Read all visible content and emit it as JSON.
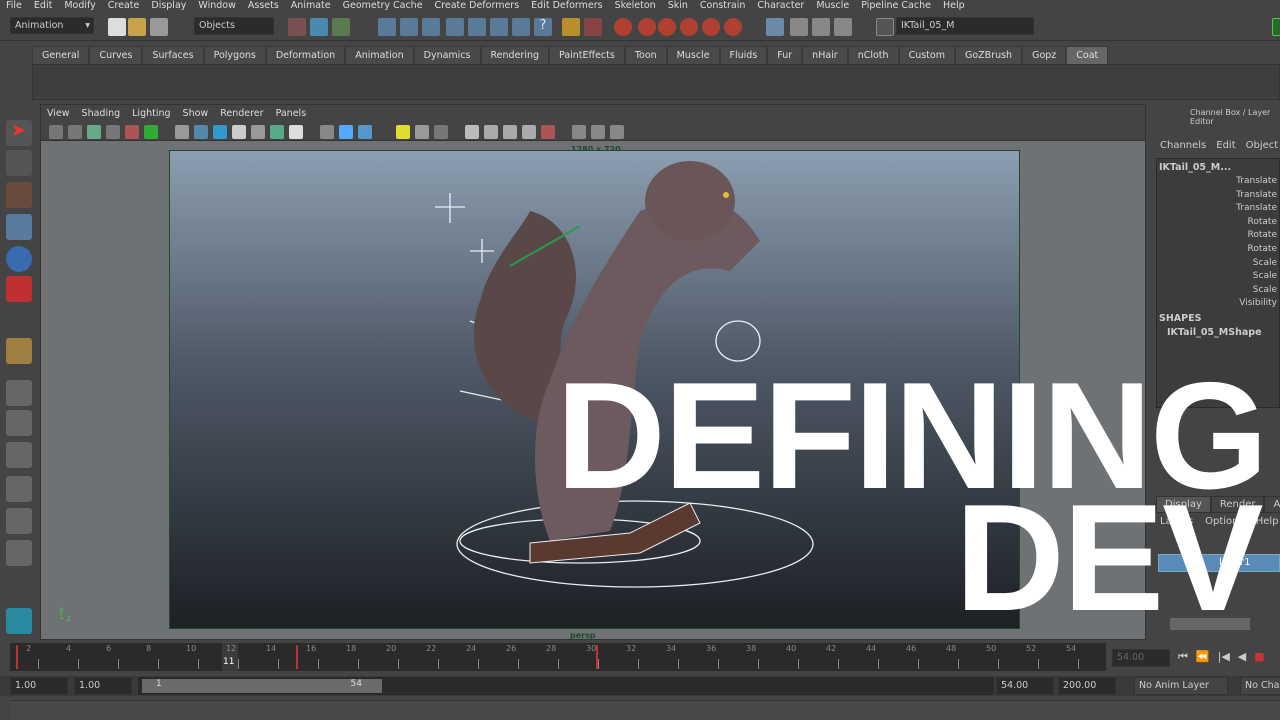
{
  "menus": [
    "File",
    "Edit",
    "Modify",
    "Create",
    "Display",
    "Window",
    "Assets",
    "Animate",
    "Geometry Cache",
    "Create Deformers",
    "Edit Deformers",
    "Skeleton",
    "Skin",
    "Constrain",
    "Character",
    "Muscle",
    "Pipeline Cache",
    "Help"
  ],
  "toolbar": {
    "mode": "Animation",
    "selection_mask": "Objects",
    "selected_object": "IKTail_05_M"
  },
  "shelf_tabs": [
    "General",
    "Curves",
    "Surfaces",
    "Polygons",
    "Deformation",
    "Animation",
    "Dynamics",
    "Rendering",
    "PaintEffects",
    "Toon",
    "Muscle",
    "Fluids",
    "Fur",
    "nHair",
    "nCloth",
    "Custom",
    "GoZBrush",
    "Gopz",
    "Coat"
  ],
  "shelf_active": "Coat",
  "viewport": {
    "menus": [
      "View",
      "Shading",
      "Lighting",
      "Show",
      "Renderer",
      "Panels"
    ],
    "resolution": "1280 x 720",
    "camera": "persp"
  },
  "channel_box": {
    "title": "Channel Box / Layer Editor",
    "menus": [
      "Channels",
      "Edit",
      "Object"
    ],
    "object": "IKTail_05_M...",
    "channels": [
      "Translate",
      "Translate",
      "Translate",
      "Rotate",
      "Rotate",
      "Rotate",
      "Scale",
      "Scale",
      "Scale",
      "Visibility"
    ],
    "shapes_label": "SHAPES",
    "shape": "IKTail_05_MShape"
  },
  "layer_editor": {
    "tabs": [
      "Display",
      "Render",
      "Anim"
    ],
    "menus": [
      "Layers",
      "Options",
      "Help"
    ],
    "layer": "layer1"
  },
  "timeline": {
    "ticks": [
      "2",
      "4",
      "6",
      "8",
      "10",
      "12",
      "14",
      "16",
      "18",
      "20",
      "22",
      "24",
      "26",
      "28",
      "30",
      "32",
      "34",
      "36",
      "38",
      "40",
      "42",
      "44",
      "46",
      "48",
      "50",
      "52",
      "54"
    ],
    "current_frame": "11",
    "end_field": "54.00"
  },
  "range": {
    "start": "1.00",
    "anim_start": "1.00",
    "range_start": "1",
    "range_end": "54",
    "anim_end": "54.00",
    "end": "200.00",
    "anim_layer": "No Anim Layer",
    "character": "No Character"
  },
  "overlay": {
    "line1": "DEFINING",
    "line2": "DEV"
  }
}
